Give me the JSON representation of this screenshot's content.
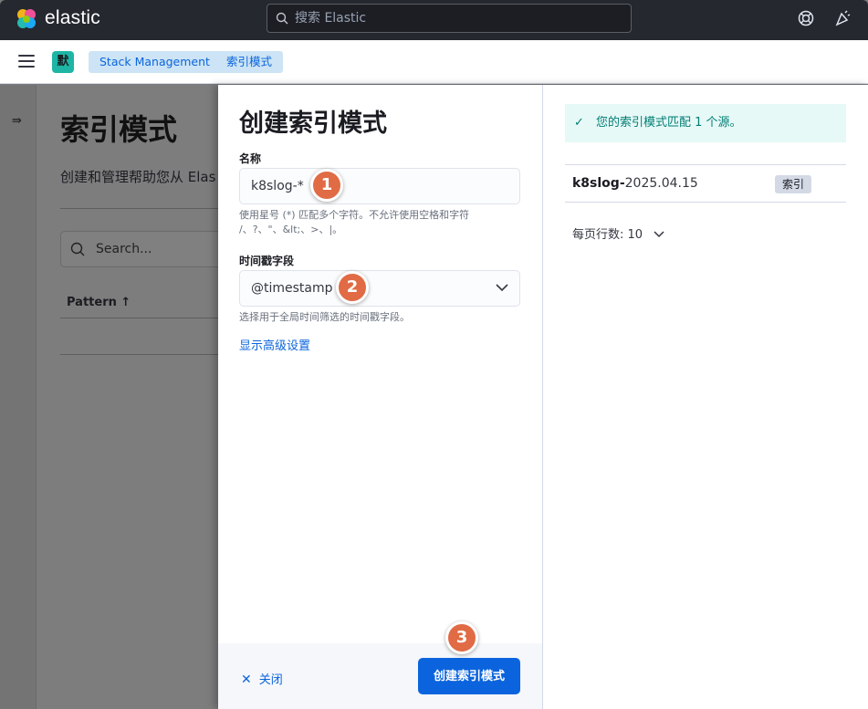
{
  "header": {
    "brand": "elastic",
    "search_placeholder": "搜索 Elastic",
    "icons": [
      "help-icon",
      "newsfeed-icon"
    ]
  },
  "breadcrumbs": {
    "space_initial": "默",
    "items": [
      "Stack Management",
      "索引模式"
    ]
  },
  "background_page": {
    "title": "索引模式",
    "description": "创建和管理帮助您从 Elas",
    "search_placeholder": "Search...",
    "column_pattern": "Pattern ↑"
  },
  "flyout": {
    "title": "创建索引模式",
    "name_label": "名称",
    "name_value": "k8slog-*",
    "name_help": "使用星号 (*) 匹配多个字符。不允许使用空格和字符 /、?、\"、&lt;、>、|。",
    "timestamp_label": "时间戳字段",
    "timestamp_value": "@timestamp",
    "timestamp_help": "选择用于全局时间筛选的时间戳字段。",
    "advanced_link": "显示高级设置",
    "close_label": "关闭",
    "create_label": "创建索引模式"
  },
  "steps": [
    "1",
    "2",
    "3"
  ],
  "results": {
    "callout": "您的索引模式匹配 1 个源。",
    "item_name_bold": "k8slog-",
    "item_name_rest": "2025.04.15",
    "item_badge": "索引",
    "rows_per_page": "每页行数: 10"
  },
  "colors": {
    "primary": "#0b64dd",
    "step": "#e06b45",
    "success": "#017d73"
  }
}
